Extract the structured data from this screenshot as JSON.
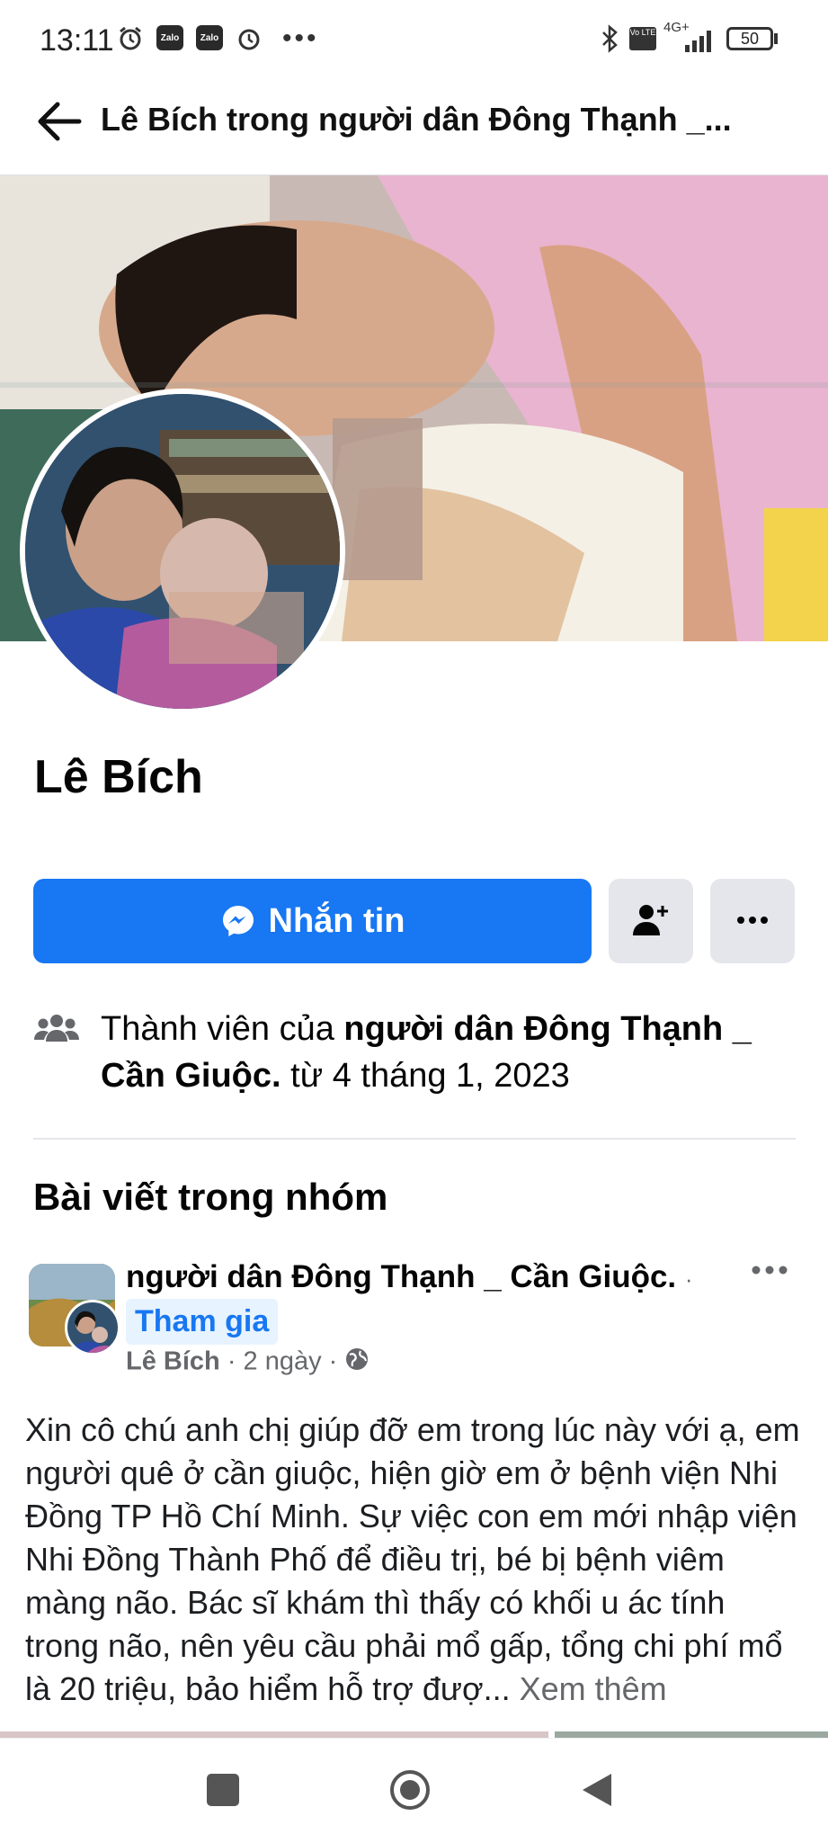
{
  "status_bar": {
    "time": "13:11",
    "zalo_label": "Zalo",
    "volte_label": "Vo LTE",
    "network": "4G+",
    "battery": "50"
  },
  "header": {
    "title": "Lê Bích trong người dân Đông Thạnh _..."
  },
  "profile": {
    "name": "Lê Bích",
    "message_button": "Nhắn tin",
    "membership_prefix": "Thành viên của ",
    "membership_group": "người dân Đông Thạnh _ Cần Giuộc.",
    "membership_suffix": " từ 4 tháng 1, 2023"
  },
  "posts_section": {
    "heading": "Bài viết trong nhóm"
  },
  "post": {
    "group_name": "người dân Đông Thạnh _ Cần Giuộc.",
    "separator": "·",
    "join_label": "Tham gia",
    "author": "Lê Bích",
    "time": "· 2 ngày ·",
    "body": "Xin cô chú anh chị giúp đỡ em trong lúc này với ạ, em người quê ở cần giuộc, hiện giờ em ở bệnh viện Nhi Đồng TP Hồ Chí Minh. Sự việc con em mới nhập viện Nhi Đồng Thành Phố để điều trị, bé bị bệnh viêm màng não. Bác sĩ khám thì thấy có khối u ác tính trong não, nên yêu cầu phải mổ gấp, tổng chi phí mổ là 20 triệu, bảo hiểm hỗ trợ đượ...",
    "see_more": "Xem thêm"
  },
  "colors": {
    "brand_blue": "#1877f2",
    "secondary_button": "#e4e6eb",
    "join_bg": "#e7f3ff",
    "meta_gray": "#65676b"
  },
  "icons": [
    "back-arrow-icon",
    "messenger-icon",
    "add-friend-icon",
    "more-icon",
    "group-members-icon",
    "globe-icon",
    "recents-icon",
    "home-icon",
    "back-triangle-icon"
  ]
}
